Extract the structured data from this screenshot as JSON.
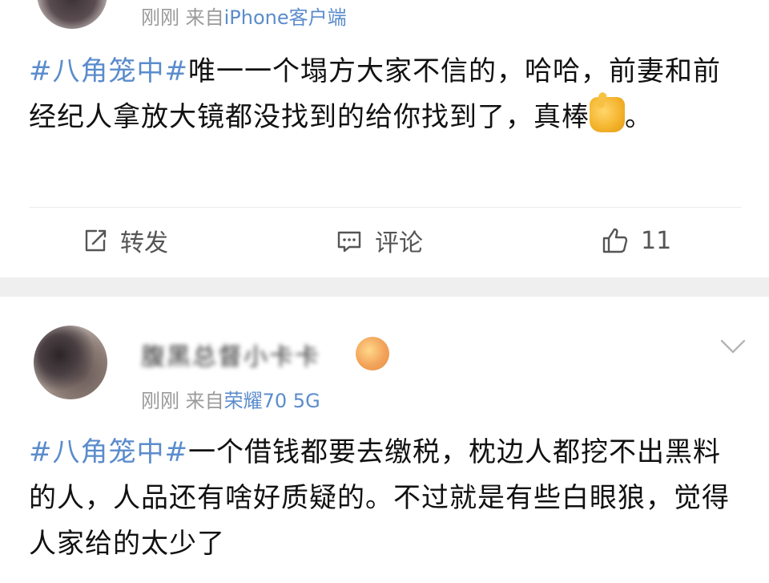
{
  "post1": {
    "meta_time": "刚刚",
    "meta_from": "来自",
    "meta_source": "iPhone客户端",
    "hashtag": "#八角笼中#",
    "text": "唯一一个塌方大家不信的，哈哈，前妻和前经纪人拿放大镜都没找到的给你找到了，真棒",
    "text_end": "。",
    "emoji_icon": "thumbs-up-icon",
    "actions": {
      "repost_label": "转发",
      "comment_label": "评论",
      "like_count": "11"
    }
  },
  "post2": {
    "username": "腹黑总督小卡卡",
    "meta_time": "刚刚",
    "meta_from": "来自",
    "meta_source": "荣耀70 5G",
    "hashtag": "#八角笼中#",
    "text": "一个借钱都要去缴税，枕边人都挖不出黑料的人，人品还有啥好质疑的。不过就是有些白眼狼，觉得人家给的太少了"
  },
  "colors": {
    "link_blue": "#5b8ccc",
    "meta_gray": "#9a9a9a",
    "separator": "#efefef"
  }
}
